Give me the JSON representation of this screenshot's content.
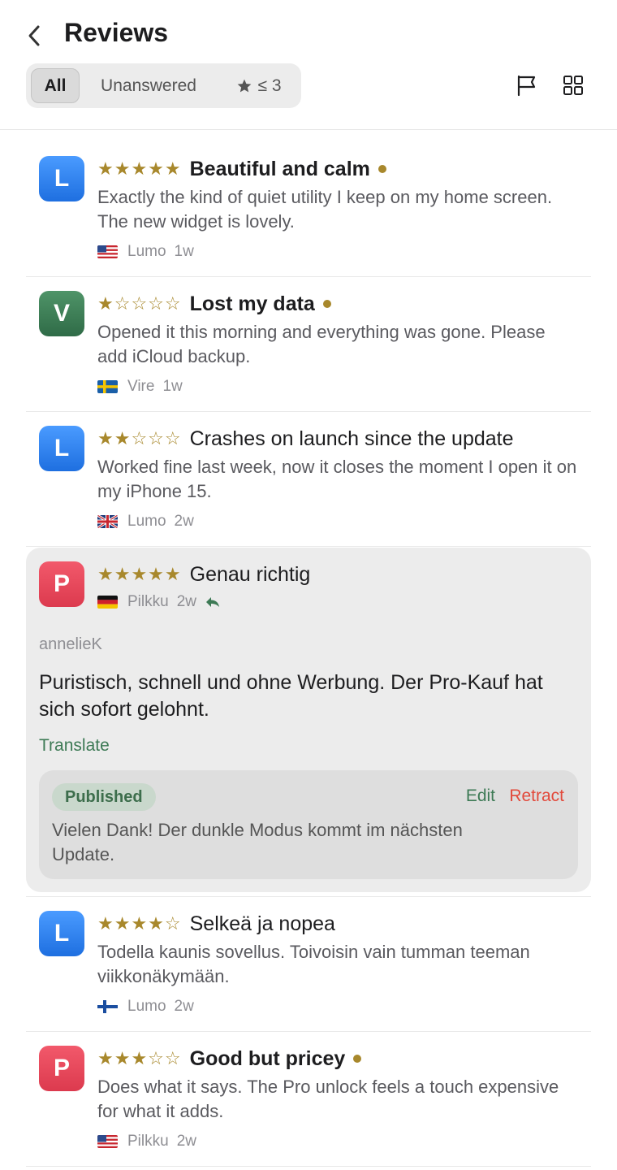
{
  "header": {
    "title": "Reviews",
    "filters": {
      "all": "All",
      "unanswered": "Unanswered",
      "rating": "≤ 3"
    }
  },
  "reviews": [
    {
      "initial": "L",
      "stars": "★★★★★",
      "rating": 5,
      "title": "Beautiful and calm",
      "unread": true,
      "body": "Exactly the kind of quiet utility I keep on my home screen. The new widget is lovely.",
      "author": "Lumo",
      "age": "1w",
      "country": "us"
    },
    {
      "initial": "V",
      "stars": "★☆☆☆☆",
      "rating": 1,
      "title": "Lost my data",
      "unread": true,
      "body": "Opened it this morning and everything was gone. Please add iCloud backup.",
      "author": "Vire",
      "age": "1w",
      "country": "se"
    },
    {
      "initial": "L",
      "stars": "★★☆☆☆",
      "rating": 2,
      "title": "Crashes on launch since the update",
      "unread": false,
      "body": "Worked fine last week, now it closes the moment I open it on my iPhone 15.",
      "author": "Lumo",
      "age": "2w",
      "country": "gb"
    },
    {
      "initial": "P",
      "stars": "★★★★★",
      "rating": 5,
      "title": "Genau richtig",
      "unread": false,
      "author": "Pilkku",
      "age": "2w",
      "country": "de",
      "replied": true,
      "reviewer": "annelieK",
      "body": "Puristisch, schnell und ohne Werbung. Der Pro-Kauf hat sich sofort gelohnt.",
      "translate": "Translate",
      "reply": {
        "status": "Published",
        "edit": "Edit",
        "retract": "Retract",
        "text": "Vielen Dank! Der dunkle Modus kommt im nächsten Update."
      }
    },
    {
      "initial": "L",
      "stars": "★★★★☆",
      "rating": 4,
      "title": "Selkeä ja nopea",
      "unread": false,
      "body": "Todella kaunis sovellus. Toivoisin vain tumman teeman viikkonäkymään.",
      "author": "Lumo",
      "age": "2w",
      "country": "fi"
    },
    {
      "initial": "P",
      "stars": "★★★☆☆",
      "rating": 3,
      "title": "Good but pricey",
      "unread": true,
      "body": "Does what it says. The Pro unlock feels a touch expensive for what it adds.",
      "author": "Pilkku",
      "age": "2w",
      "country": "us"
    }
  ],
  "colors": {
    "star": "#a8882c",
    "accent_green": "#3d7a55",
    "retract_red": "#e2493b"
  }
}
